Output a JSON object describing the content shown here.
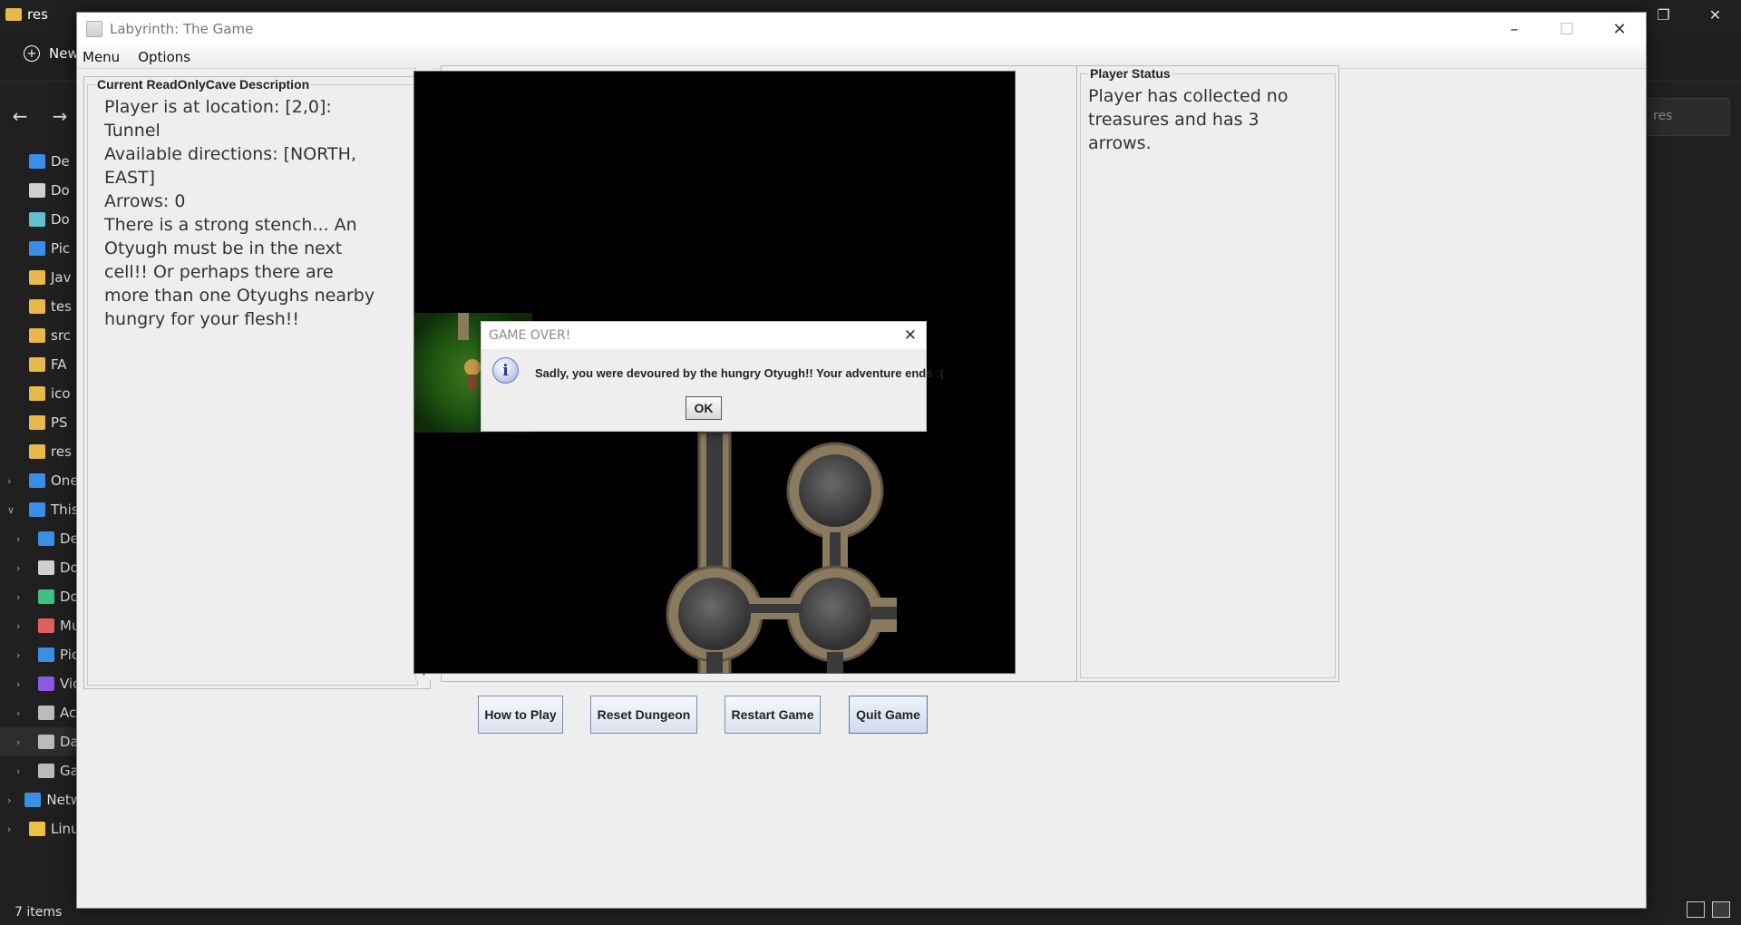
{
  "explorer": {
    "title": "res",
    "new_label": "New",
    "search_placeholder": "res",
    "status": "7 items",
    "sidebar": [
      {
        "label": "De",
        "icon": "desktop-icon",
        "color": "#3a8ee6"
      },
      {
        "label": "Do",
        "icon": "document-icon",
        "color": "#d0d0d0"
      },
      {
        "label": "Do",
        "icon": "cloud-icon",
        "color": "#60c0d0"
      },
      {
        "label": "Pic",
        "icon": "pictures-icon",
        "color": "#3a8ee6"
      },
      {
        "label": "Jav",
        "icon": "folder-icon",
        "color": "#e8b84a"
      },
      {
        "label": "tes",
        "icon": "folder-icon",
        "color": "#e8b84a"
      },
      {
        "label": "src",
        "icon": "folder-icon",
        "color": "#e8b84a"
      },
      {
        "label": "FA",
        "icon": "folder-icon",
        "color": "#e8b84a"
      },
      {
        "label": "ico",
        "icon": "folder-icon",
        "color": "#e8b84a"
      },
      {
        "label": "PS",
        "icon": "folder-icon",
        "color": "#e8b84a"
      },
      {
        "label": "res",
        "icon": "folder-icon",
        "color": "#e8b84a"
      },
      {
        "label": "One",
        "icon": "onedrive-icon",
        "color": "#3a8ee6"
      },
      {
        "label": "This",
        "icon": "computer-icon",
        "color": "#3a8ee6"
      },
      {
        "label": "De",
        "icon": "desktop-icon",
        "color": "#3a8ee6"
      },
      {
        "label": "Do",
        "icon": "document-icon",
        "color": "#d0d0d0"
      },
      {
        "label": "Do",
        "icon": "download-icon",
        "color": "#40c080"
      },
      {
        "label": "Mu",
        "icon": "music-icon",
        "color": "#e06060"
      },
      {
        "label": "Pic",
        "icon": "pictures-icon",
        "color": "#3a8ee6"
      },
      {
        "label": "Vid",
        "icon": "videos-icon",
        "color": "#8a5ae0"
      },
      {
        "label": "Ac",
        "icon": "drive-icon",
        "color": "#bbbbbb"
      },
      {
        "label": "Da",
        "icon": "drive-icon",
        "color": "#bbbbbb"
      },
      {
        "label": "Ga",
        "icon": "drive-icon",
        "color": "#bbbbbb"
      },
      {
        "label": "Netw",
        "icon": "network-icon",
        "color": "#3a8ee6"
      },
      {
        "label": "Linu",
        "icon": "linux-icon",
        "color": "#f0c040"
      }
    ]
  },
  "window": {
    "title": "Labyrinth: The Game",
    "menu": [
      "Menu",
      "Options"
    ]
  },
  "description": {
    "legend": "Current ReadOnlyCave Description",
    "lines": [
      "Player is at location: [2,0]:",
      "Tunnel",
      "Available directions: [NORTH,",
      "EAST]",
      "Arrows: 0",
      "There is a strong stench... An",
      "Otyugh must be in the next",
      "cell!! Or perhaps there are",
      "more than one Otyughs nearby",
      "hungry for your flesh!!"
    ]
  },
  "status": {
    "legend": "Player Status",
    "lines": [
      "Player has collected no",
      "treasures and has 3 arrows."
    ]
  },
  "buttons": {
    "how_to_play": "How to Play",
    "reset_dungeon": "Reset Dungeon",
    "restart_game": "Restart Game",
    "quit_game": "Quit Game"
  },
  "dialog": {
    "title": "GAME OVER!",
    "message": "Sadly, you were devoured by the hungry Otyugh!! Your adventure ends :(",
    "ok": "OK"
  }
}
